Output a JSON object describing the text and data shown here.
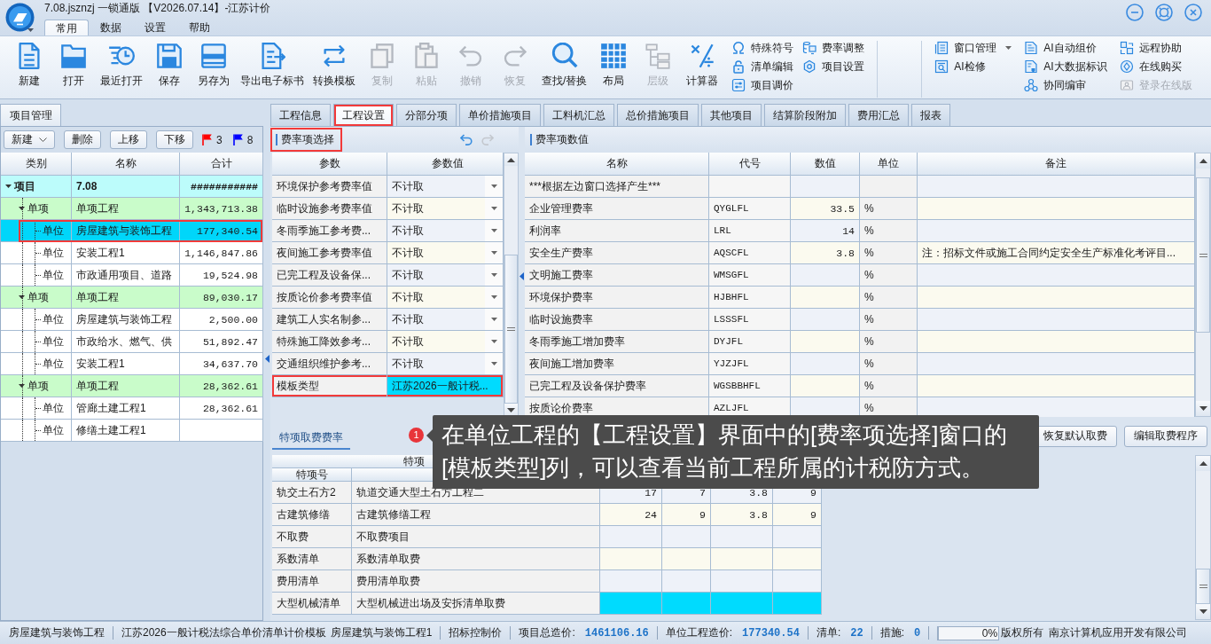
{
  "window": {
    "title": "7.08.jsznzj 一锁通版 【V2026.07.14】-江苏计价"
  },
  "menu_tabs": [
    {
      "label": "常用",
      "selected": true
    },
    {
      "label": "数据",
      "selected": false
    },
    {
      "label": "设置",
      "selected": false
    },
    {
      "label": "帮助",
      "selected": false
    }
  ],
  "ribbon": {
    "large_buttons": [
      {
        "label": "新建",
        "disabled": false
      },
      {
        "label": "打开",
        "disabled": false
      },
      {
        "label": "最近打开",
        "disabled": false
      },
      {
        "label": "保存",
        "disabled": false
      },
      {
        "label": "另存为",
        "disabled": false
      },
      {
        "label": "导出电子标书",
        "disabled": false
      },
      {
        "label": "转换模板",
        "disabled": false
      },
      {
        "label": "复制",
        "disabled": true
      },
      {
        "label": "粘贴",
        "disabled": true
      },
      {
        "label": "撤销",
        "disabled": true
      },
      {
        "label": "恢复",
        "disabled": true
      },
      {
        "label": "查找/替换",
        "disabled": false
      },
      {
        "label": "布局",
        "disabled": false
      },
      {
        "label": "层级",
        "disabled": true
      },
      {
        "label": "计算器",
        "disabled": false
      }
    ],
    "small_columns": [
      [
        {
          "label": "特殊符号",
          "disabled": false,
          "dropdown": false
        },
        {
          "label": "清单编辑",
          "disabled": false,
          "dropdown": false
        },
        {
          "label": "项目调价",
          "disabled": false,
          "dropdown": false
        }
      ],
      [
        {
          "label": "费率调整",
          "disabled": false,
          "dropdown": false
        },
        {
          "label": "项目设置",
          "disabled": false,
          "dropdown": false
        }
      ]
    ],
    "right_columns": [
      [
        {
          "label": "窗口管理",
          "disabled": false,
          "dropdown": true
        },
        {
          "label": "AI检修",
          "disabled": false,
          "dropdown": false
        }
      ],
      [
        {
          "label": "AI自动组价",
          "disabled": false,
          "dropdown": false
        },
        {
          "label": "AI大数据标识",
          "disabled": false,
          "dropdown": false
        },
        {
          "label": "协同编审",
          "disabled": false,
          "dropdown": false
        }
      ],
      [
        {
          "label": "远程协助",
          "disabled": false,
          "dropdown": false
        },
        {
          "label": "在线购买",
          "disabled": false,
          "dropdown": false
        },
        {
          "label": "登录在线版",
          "disabled": true,
          "dropdown": false
        }
      ]
    ]
  },
  "project_panel": {
    "tab": "项目管理",
    "toolbar": [
      {
        "label": "新建",
        "dropdown": true
      },
      {
        "label": "删除",
        "dropdown": false
      },
      {
        "label": "上移",
        "dropdown": false
      },
      {
        "label": "下移",
        "dropdown": false
      }
    ],
    "flags": [
      {
        "color": "#ff0000",
        "count": "3"
      },
      {
        "color": "#0000ff",
        "count": "8"
      }
    ],
    "columns": [
      "类别",
      "名称",
      "合计"
    ],
    "tree": [
      {
        "type": "项目",
        "name": "7.08",
        "total": "###########",
        "selected": false,
        "highlighted": false,
        "expanded": true,
        "children": [
          {
            "type": "单项",
            "name": "单项工程",
            "total": "1,343,713.38",
            "selected": false,
            "highlighted": false,
            "expanded": true,
            "children": [
              {
                "type": "单位",
                "name": "房屋建筑与装饰工程",
                "total": "177,340.54",
                "selected": true,
                "highlighted": true,
                "expanded": false
              },
              {
                "type": "单位",
                "name": "安装工程1",
                "total": "1,146,847.86",
                "selected": false,
                "highlighted": false,
                "expanded": false
              },
              {
                "type": "单位",
                "name": "市政通用项目、道路",
                "total": "19,524.98",
                "selected": false,
                "highlighted": false,
                "expanded": false
              }
            ]
          },
          {
            "type": "单项",
            "name": "单项工程",
            "total": "89,030.17",
            "selected": false,
            "highlighted": false,
            "expanded": true,
            "children": [
              {
                "type": "单位",
                "name": "房屋建筑与装饰工程",
                "total": "2,500.00",
                "selected": false,
                "highlighted": false,
                "expanded": false
              },
              {
                "type": "单位",
                "name": "市政给水、燃气、供",
                "total": "51,892.47",
                "selected": false,
                "highlighted": false,
                "expanded": false
              },
              {
                "type": "单位",
                "name": "安装工程1",
                "total": "34,637.70",
                "selected": false,
                "highlighted": false,
                "expanded": false
              }
            ]
          },
          {
            "type": "单项",
            "name": "单项工程",
            "total": "28,362.61",
            "selected": false,
            "highlighted": false,
            "expanded": true,
            "children": [
              {
                "type": "单位",
                "name": "管廊土建工程1",
                "total": "28,362.61",
                "selected": false,
                "highlighted": false,
                "expanded": false
              },
              {
                "type": "单位",
                "name": "修缮土建工程1",
                "selected": false,
                "highlighted": false,
                "expanded": false
              }
            ]
          }
        ]
      }
    ]
  },
  "tabs": [
    {
      "label": "工程信息",
      "selected": false,
      "highlighted": false
    },
    {
      "label": "工程设置",
      "selected": true,
      "highlighted": true
    },
    {
      "label": "分部分项",
      "selected": false,
      "highlighted": false
    },
    {
      "label": "单价措施项目",
      "selected": false,
      "highlighted": false
    },
    {
      "label": "工料机汇总",
      "selected": false,
      "highlighted": false
    },
    {
      "label": "总价措施项目",
      "selected": false,
      "highlighted": false
    },
    {
      "label": "其他项目",
      "selected": false,
      "highlighted": false
    },
    {
      "label": "结算阶段附加",
      "selected": false,
      "highlighted": false
    },
    {
      "label": "费用汇总",
      "selected": false,
      "highlighted": false
    },
    {
      "label": "报表",
      "selected": false,
      "highlighted": false
    }
  ],
  "rate_selection": {
    "title": "费率项选择",
    "highlighted": true,
    "columns": [
      "参数",
      "参数值"
    ],
    "rows": [
      {
        "name": "环境保护参考费率值",
        "value": "不计取",
        "kind": "dropdown",
        "selected": false,
        "highlighted": false
      },
      {
        "name": "临时设施参考费率值",
        "value": "不计取",
        "kind": "dropdown",
        "selected": false,
        "highlighted": false
      },
      {
        "name": "冬雨季施工参考费...",
        "value": "不计取",
        "kind": "dropdown",
        "selected": false,
        "highlighted": false
      },
      {
        "name": "夜间施工参考费率值",
        "value": "不计取",
        "kind": "dropdown",
        "selected": false,
        "highlighted": false
      },
      {
        "name": "已完工程及设备保...",
        "value": "不计取",
        "kind": "dropdown",
        "selected": false,
        "highlighted": false
      },
      {
        "name": "按质论价参考费率值",
        "value": "不计取",
        "kind": "dropdown",
        "selected": false,
        "highlighted": false
      },
      {
        "name": "建筑工人实名制参...",
        "value": "不计取",
        "kind": "dropdown",
        "selected": false,
        "highlighted": false
      },
      {
        "name": "特殊施工降效参考...",
        "value": "不计取",
        "kind": "dropdown",
        "selected": false,
        "highlighted": false
      },
      {
        "name": "交通组织维护参考...",
        "value": "不计取",
        "kind": "dropdown",
        "selected": false,
        "highlighted": false
      },
      {
        "name": "模板类型",
        "value": "江苏2026一般计税...",
        "kind": "text",
        "selected": true,
        "highlighted": true
      }
    ]
  },
  "rate_values": {
    "title": "费率项数值",
    "highlighted": false,
    "columns": [
      "名称",
      "代号",
      "数值",
      "单位",
      "备注"
    ],
    "rows": [
      {
        "name": "***根据左边窗口选择产生***"
      },
      {
        "name": "企业管理费率",
        "code": "QYGLFL",
        "value": "33.5",
        "unit": "%"
      },
      {
        "name": "利润率",
        "code": "LRL",
        "value": "14",
        "unit": "%"
      },
      {
        "name": "安全生产费率",
        "code": "AQSCFL",
        "value": "3.8",
        "unit": "%",
        "remark": "注：招标文件或施工合同约定安全生产标准化考评目..."
      },
      {
        "name": "文明施工费率",
        "code": "WMSGFL",
        "unit": "%"
      },
      {
        "name": "环境保护费率",
        "code": "HJBHFL",
        "unit": "%"
      },
      {
        "name": "临时设施费率",
        "code": "LSSSFL",
        "unit": "%"
      },
      {
        "name": "冬雨季施工增加费率",
        "code": "DYJFL",
        "unit": "%"
      },
      {
        "name": "夜间施工增加费率",
        "code": "YJZJFL",
        "unit": "%"
      },
      {
        "name": "已完工程及设备保护费率",
        "code": "WGSBBHFL",
        "unit": "%"
      },
      {
        "name": "按质论价费率",
        "code": "AZLJFL",
        "unit": "%"
      }
    ]
  },
  "special_rates": {
    "tab": "特项取费费率",
    "buttons": [
      "恢复默认取费",
      "编辑取费程序"
    ],
    "group_header": "特项",
    "columns": [
      "特项号"
    ],
    "rows": [
      {
        "code": "轨交土石方2",
        "name": "轨道交通大型土石方工程二",
        "values": [
          "17",
          "7",
          "3.8",
          "9"
        ],
        "selected": false
      },
      {
        "code": "古建筑修缮",
        "name": "古建筑修缮工程",
        "values": [
          "24",
          "9",
          "3.8",
          "9"
        ],
        "selected": false
      },
      {
        "code": "不取费",
        "name": "不取费项目",
        "selected": false
      },
      {
        "code": "系数清单",
        "name": "系数清单取费",
        "selected": false
      },
      {
        "code": "费用清单",
        "name": "费用清单取费",
        "selected": false
      },
      {
        "code": "大型机械清单",
        "name": "大型机械进出场及安拆清单取费",
        "selected": true
      }
    ]
  },
  "tooltip": {
    "badge": "1",
    "text": "在单位工程的【工程设置】界面中的[费率项选择]窗口的[模板类型]列，可以查看当前工程所属的计税防方式。"
  },
  "status_bar": {
    "segments": [
      {
        "kind": "text",
        "texts": [
          "房屋建筑与装饰工程"
        ]
      },
      {
        "kind": "text",
        "texts": [
          "江苏2026一般计税法综合单价清单计价模板",
          "房屋建筑与装饰工程1"
        ]
      },
      {
        "kind": "text",
        "texts": [
          "招标控制价"
        ]
      },
      {
        "kind": "field",
        "label": "项目总造价:",
        "value": "1461106.16"
      },
      {
        "kind": "field",
        "label": "单位工程造价:",
        "value": "177340.54"
      },
      {
        "kind": "field",
        "label": "清单:",
        "value": "22"
      },
      {
        "kind": "field",
        "label": "措施:",
        "value": "0"
      }
    ],
    "progress": {
      "level": 0,
      "label": "0%"
    },
    "copyright": "版权所有",
    "company": "南京计算机应用开发有限公司"
  }
}
